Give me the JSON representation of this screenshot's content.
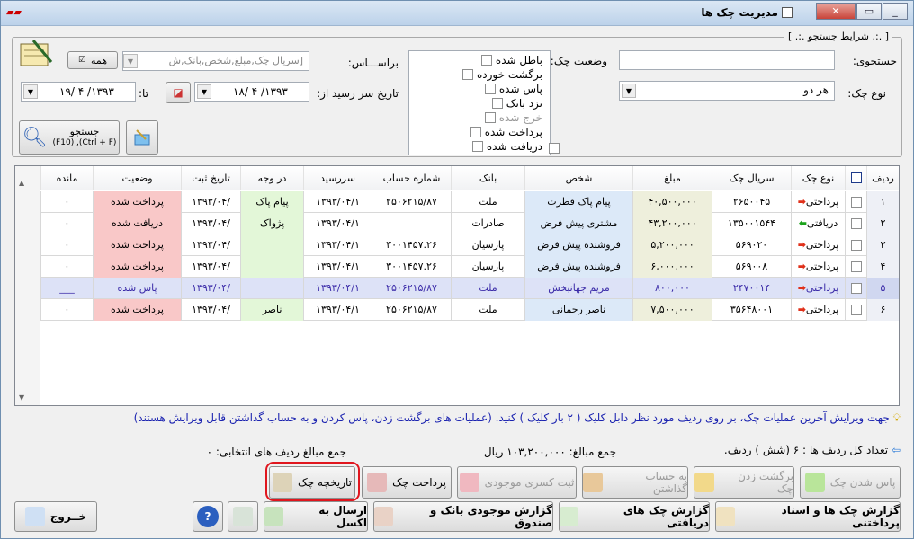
{
  "window": {
    "title": "مدیریت چک ها",
    "app_icon": "app-logo",
    "btn_min": "_",
    "btn_max": "▭",
    "btn_close": "✕"
  },
  "filters": {
    "group_title": "[ .:. شرایط جستجو .:. ]",
    "search_label": "جستجوی:",
    "search_value": "",
    "status_label": "وضعیت چک:",
    "type_label": "نوع چک:",
    "type_value": "هر دو",
    "based_on_label": "براســـاس:",
    "based_on_placeholder": "[سریال چک,مبلغ,شخص,بانک,ش",
    "all_button": "همه",
    "due_from_label": "تاریخ سر رسید از:",
    "due_from_value": "۱۳۹۳/ ۴ /۱۸",
    "to_label": "تا:",
    "due_to_value": "۱۳۹۳/ ۴ /۱۹",
    "search_button": "جستجو",
    "search_shortcut": "(Ctrl + F), (F10)",
    "statuses": [
      {
        "label": "باطل شده",
        "disabled": false
      },
      {
        "label": "برگشت خورده",
        "disabled": false
      },
      {
        "label": "پاس شده",
        "disabled": false
      },
      {
        "label": "نزد بانک",
        "disabled": false
      },
      {
        "label": "خرج شده",
        "disabled": true
      },
      {
        "label": "پرداخت شده",
        "disabled": false
      },
      {
        "label": "دریافت شده",
        "disabled": false
      }
    ]
  },
  "grid": {
    "headers": [
      "ردیف",
      "نوع چک",
      "سریال چک",
      "مبلغ",
      "شخص",
      "بانک",
      "شماره حساب",
      "سررسید",
      "در وجه",
      "تاریخ ثبت",
      "وضعیت",
      "مانده"
    ],
    "rows": [
      {
        "n": "۱",
        "type": "پرداختی",
        "serial": "۲۶۵۰۰۴۵",
        "amount": "۴۰,۵۰۰,۰۰۰",
        "person": "پیام پاک فطرت",
        "bank": "ملت",
        "account": "۲۵۰۶۲۱۵/۸۷",
        "due": "۱۳۹۳/۰۴/۱",
        "payee": "پیام پاک",
        "reg": "/۱۳۹۳/۰۴",
        "status": "پرداخت شده",
        "remain": "۰"
      },
      {
        "n": "۲",
        "type": "دریافتی",
        "serial": "۱۳۵۰۰۱۵۴۴",
        "amount": "۴۳,۲۰۰,۰۰۰",
        "person": "مشتری پیش فرض",
        "bank": "صادرات",
        "account": "",
        "due": "۱۳۹۳/۰۴/۱",
        "payee": "پژواک",
        "reg": "/۱۳۹۳/۰۴",
        "status": "دریافت شده",
        "remain": "۰"
      },
      {
        "n": "۳",
        "type": "پرداختی",
        "serial": "۵۶۹۰۲۰",
        "amount": "۵,۲۰۰,۰۰۰",
        "person": "فروشنده پیش فرض",
        "bank": "پارسیان",
        "account": "۳۰۰۱۴۵۷.۲۶",
        "due": "۱۳۹۳/۰۴/۱",
        "payee": "",
        "reg": "/۱۳۹۳/۰۴",
        "status": "پرداخت شده",
        "remain": "۰"
      },
      {
        "n": "۴",
        "type": "پرداختی",
        "serial": "۵۶۹۰۰۸",
        "amount": "۶,۰۰۰,۰۰۰",
        "person": "فروشنده پیش فرض",
        "bank": "پارسیان",
        "account": "۳۰۰۱۴۵۷.۲۶",
        "due": "۱۳۹۳/۰۴/۱",
        "payee": "",
        "reg": "/۱۳۹۳/۰۴",
        "status": "پرداخت شده",
        "remain": "۰"
      },
      {
        "n": "۵",
        "type": "پرداختی",
        "serial": "۲۴۷۰۰۱۴",
        "amount": "۸۰۰,۰۰۰",
        "person": "مریم جهانبخش",
        "bank": "ملت",
        "account": "۲۵۰۶۲۱۵/۸۷",
        "due": "۱۳۹۳/۰۴/۱",
        "payee": "",
        "reg": "/۱۳۹۳/۰۴",
        "status": "پاس شده",
        "remain": "___"
      },
      {
        "n": "۶",
        "type": "پرداختی",
        "serial": "۳۵۶۴۸۰۰۱",
        "amount": "۷,۵۰۰,۰۰۰",
        "person": "ناصر رحمانی",
        "bank": "ملت",
        "account": "۲۵۰۶۲۱۵/۸۷",
        "due": "۱۳۹۳/۰۴/۱",
        "payee": "ناصر",
        "reg": "/۱۳۹۳/۰۴",
        "status": "پرداخت شده",
        "remain": "۰"
      }
    ]
  },
  "info_text": "جهت ویرایش آخرین عملیات چک، بر روی ردیف مورد نظر دابل کلیک ( ۲ بار کلیک ) کنید. (عملیات های برگشت زدن، پاس کردن و به حساب گذاشتن قابل ویرایش هستند)",
  "totals": {
    "row_count": "تعداد کل ردیف ها : ۶ (شش ) ردیف.",
    "sum": "جمع مبالغ: ۱۰۳,۲۰۰,۰۰۰ ریال",
    "selected_sum": "جمع مبالغ ردیف های انتخابی: ۰"
  },
  "actions": {
    "pass": "پاس شدن چک",
    "bounce": "برگشت زدن چک",
    "deposit": "به حساب گذاشتن",
    "deduct": "ثبت کسری موجودی",
    "pay": "پرداخت چک",
    "history": "تاریخچه چک"
  },
  "reports": {
    "report_all": "گزارش چک ها و اسناد پرداختنی",
    "report_received": "گزارش چک های دریافتی",
    "report_bank": "گزارش موجودی بانک و صندوق",
    "excel": "ارسال به اکسل",
    "exit": "خــروج"
  },
  "colors": {
    "paid": "#f9c8c8",
    "received": "#f9c8c8",
    "passed_row": "#dde2f7",
    "amount_bg": "#eeefdc",
    "person_bg": "#dce9f8",
    "payee_bg": "#e3f7d8",
    "highlight": "#e0161e"
  }
}
